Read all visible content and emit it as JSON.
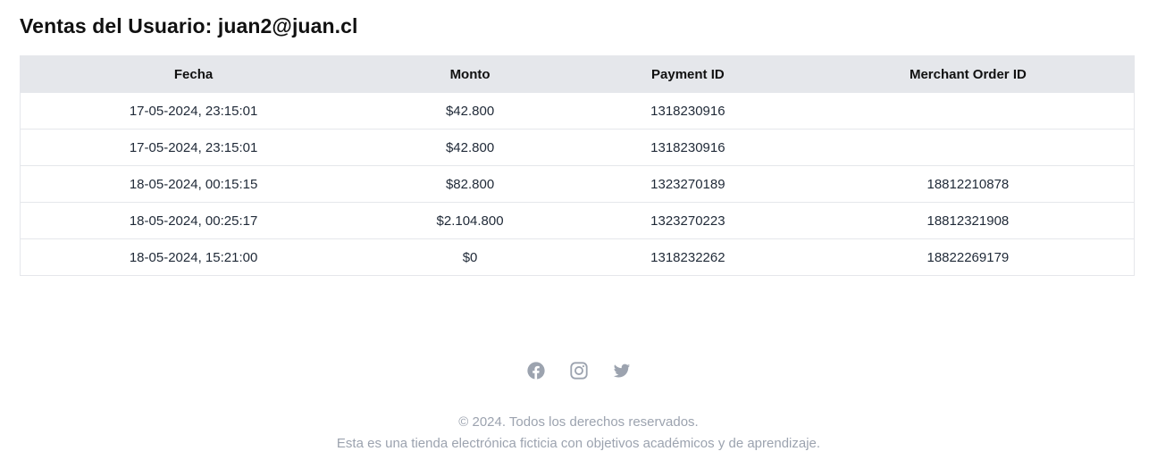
{
  "page": {
    "title": "Ventas del Usuario: juan2@juan.cl"
  },
  "table": {
    "headers": [
      "Fecha",
      "Monto",
      "Payment ID",
      "Merchant Order ID"
    ],
    "rows": [
      [
        "17-05-2024, 23:15:01",
        "$42.800",
        "1318230916",
        ""
      ],
      [
        "17-05-2024, 23:15:01",
        "$42.800",
        "1318230916",
        ""
      ],
      [
        "18-05-2024, 00:15:15",
        "$82.800",
        "1323270189",
        "18812210878"
      ],
      [
        "18-05-2024, 00:25:17",
        "$2.104.800",
        "1323270223",
        "18812321908"
      ],
      [
        "18-05-2024, 15:21:00",
        "$0",
        "1318232262",
        "18822269179"
      ]
    ]
  },
  "footer": {
    "social_icons": [
      "facebook-icon",
      "instagram-icon",
      "twitter-icon"
    ],
    "copyright": "© 2024. Todos los derechos reservados.",
    "disclaimer": "Esta es una tienda electrónica ficticia con objetivos académicos y de aprendizaje."
  },
  "colors": {
    "header_bg": "#e5e7eb",
    "border": "#e5e7eb",
    "footer_text": "#9ca3af",
    "icon": "#9ca3af"
  }
}
